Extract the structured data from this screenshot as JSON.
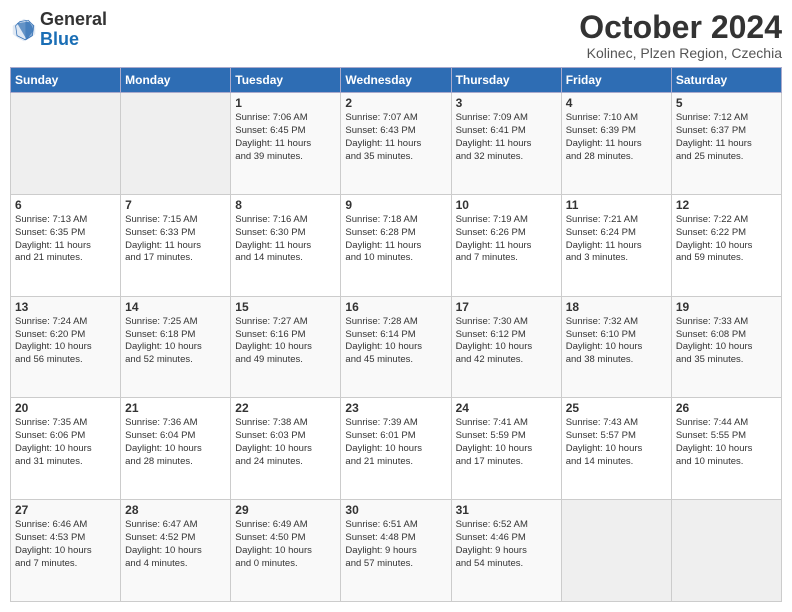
{
  "header": {
    "logo_general": "General",
    "logo_blue": "Blue",
    "title": "October 2024",
    "subtitle": "Kolinec, Plzen Region, Czechia"
  },
  "weekdays": [
    "Sunday",
    "Monday",
    "Tuesday",
    "Wednesday",
    "Thursday",
    "Friday",
    "Saturday"
  ],
  "rows": [
    [
      {
        "day": "",
        "lines": [],
        "empty": true
      },
      {
        "day": "",
        "lines": [],
        "empty": true
      },
      {
        "day": "1",
        "lines": [
          "Sunrise: 7:06 AM",
          "Sunset: 6:45 PM",
          "Daylight: 11 hours",
          "and 39 minutes."
        ],
        "empty": false
      },
      {
        "day": "2",
        "lines": [
          "Sunrise: 7:07 AM",
          "Sunset: 6:43 PM",
          "Daylight: 11 hours",
          "and 35 minutes."
        ],
        "empty": false
      },
      {
        "day": "3",
        "lines": [
          "Sunrise: 7:09 AM",
          "Sunset: 6:41 PM",
          "Daylight: 11 hours",
          "and 32 minutes."
        ],
        "empty": false
      },
      {
        "day": "4",
        "lines": [
          "Sunrise: 7:10 AM",
          "Sunset: 6:39 PM",
          "Daylight: 11 hours",
          "and 28 minutes."
        ],
        "empty": false
      },
      {
        "day": "5",
        "lines": [
          "Sunrise: 7:12 AM",
          "Sunset: 6:37 PM",
          "Daylight: 11 hours",
          "and 25 minutes."
        ],
        "empty": false
      }
    ],
    [
      {
        "day": "6",
        "lines": [
          "Sunrise: 7:13 AM",
          "Sunset: 6:35 PM",
          "Daylight: 11 hours",
          "and 21 minutes."
        ],
        "empty": false
      },
      {
        "day": "7",
        "lines": [
          "Sunrise: 7:15 AM",
          "Sunset: 6:33 PM",
          "Daylight: 11 hours",
          "and 17 minutes."
        ],
        "empty": false
      },
      {
        "day": "8",
        "lines": [
          "Sunrise: 7:16 AM",
          "Sunset: 6:30 PM",
          "Daylight: 11 hours",
          "and 14 minutes."
        ],
        "empty": false
      },
      {
        "day": "9",
        "lines": [
          "Sunrise: 7:18 AM",
          "Sunset: 6:28 PM",
          "Daylight: 11 hours",
          "and 10 minutes."
        ],
        "empty": false
      },
      {
        "day": "10",
        "lines": [
          "Sunrise: 7:19 AM",
          "Sunset: 6:26 PM",
          "Daylight: 11 hours",
          "and 7 minutes."
        ],
        "empty": false
      },
      {
        "day": "11",
        "lines": [
          "Sunrise: 7:21 AM",
          "Sunset: 6:24 PM",
          "Daylight: 11 hours",
          "and 3 minutes."
        ],
        "empty": false
      },
      {
        "day": "12",
        "lines": [
          "Sunrise: 7:22 AM",
          "Sunset: 6:22 PM",
          "Daylight: 10 hours",
          "and 59 minutes."
        ],
        "empty": false
      }
    ],
    [
      {
        "day": "13",
        "lines": [
          "Sunrise: 7:24 AM",
          "Sunset: 6:20 PM",
          "Daylight: 10 hours",
          "and 56 minutes."
        ],
        "empty": false
      },
      {
        "day": "14",
        "lines": [
          "Sunrise: 7:25 AM",
          "Sunset: 6:18 PM",
          "Daylight: 10 hours",
          "and 52 minutes."
        ],
        "empty": false
      },
      {
        "day": "15",
        "lines": [
          "Sunrise: 7:27 AM",
          "Sunset: 6:16 PM",
          "Daylight: 10 hours",
          "and 49 minutes."
        ],
        "empty": false
      },
      {
        "day": "16",
        "lines": [
          "Sunrise: 7:28 AM",
          "Sunset: 6:14 PM",
          "Daylight: 10 hours",
          "and 45 minutes."
        ],
        "empty": false
      },
      {
        "day": "17",
        "lines": [
          "Sunrise: 7:30 AM",
          "Sunset: 6:12 PM",
          "Daylight: 10 hours",
          "and 42 minutes."
        ],
        "empty": false
      },
      {
        "day": "18",
        "lines": [
          "Sunrise: 7:32 AM",
          "Sunset: 6:10 PM",
          "Daylight: 10 hours",
          "and 38 minutes."
        ],
        "empty": false
      },
      {
        "day": "19",
        "lines": [
          "Sunrise: 7:33 AM",
          "Sunset: 6:08 PM",
          "Daylight: 10 hours",
          "and 35 minutes."
        ],
        "empty": false
      }
    ],
    [
      {
        "day": "20",
        "lines": [
          "Sunrise: 7:35 AM",
          "Sunset: 6:06 PM",
          "Daylight: 10 hours",
          "and 31 minutes."
        ],
        "empty": false
      },
      {
        "day": "21",
        "lines": [
          "Sunrise: 7:36 AM",
          "Sunset: 6:04 PM",
          "Daylight: 10 hours",
          "and 28 minutes."
        ],
        "empty": false
      },
      {
        "day": "22",
        "lines": [
          "Sunrise: 7:38 AM",
          "Sunset: 6:03 PM",
          "Daylight: 10 hours",
          "and 24 minutes."
        ],
        "empty": false
      },
      {
        "day": "23",
        "lines": [
          "Sunrise: 7:39 AM",
          "Sunset: 6:01 PM",
          "Daylight: 10 hours",
          "and 21 minutes."
        ],
        "empty": false
      },
      {
        "day": "24",
        "lines": [
          "Sunrise: 7:41 AM",
          "Sunset: 5:59 PM",
          "Daylight: 10 hours",
          "and 17 minutes."
        ],
        "empty": false
      },
      {
        "day": "25",
        "lines": [
          "Sunrise: 7:43 AM",
          "Sunset: 5:57 PM",
          "Daylight: 10 hours",
          "and 14 minutes."
        ],
        "empty": false
      },
      {
        "day": "26",
        "lines": [
          "Sunrise: 7:44 AM",
          "Sunset: 5:55 PM",
          "Daylight: 10 hours",
          "and 10 minutes."
        ],
        "empty": false
      }
    ],
    [
      {
        "day": "27",
        "lines": [
          "Sunrise: 6:46 AM",
          "Sunset: 4:53 PM",
          "Daylight: 10 hours",
          "and 7 minutes."
        ],
        "empty": false
      },
      {
        "day": "28",
        "lines": [
          "Sunrise: 6:47 AM",
          "Sunset: 4:52 PM",
          "Daylight: 10 hours",
          "and 4 minutes."
        ],
        "empty": false
      },
      {
        "day": "29",
        "lines": [
          "Sunrise: 6:49 AM",
          "Sunset: 4:50 PM",
          "Daylight: 10 hours",
          "and 0 minutes."
        ],
        "empty": false
      },
      {
        "day": "30",
        "lines": [
          "Sunrise: 6:51 AM",
          "Sunset: 4:48 PM",
          "Daylight: 9 hours",
          "and 57 minutes."
        ],
        "empty": false
      },
      {
        "day": "31",
        "lines": [
          "Sunrise: 6:52 AM",
          "Sunset: 4:46 PM",
          "Daylight: 9 hours",
          "and 54 minutes."
        ],
        "empty": false
      },
      {
        "day": "",
        "lines": [],
        "empty": true
      },
      {
        "day": "",
        "lines": [],
        "empty": true
      }
    ]
  ]
}
